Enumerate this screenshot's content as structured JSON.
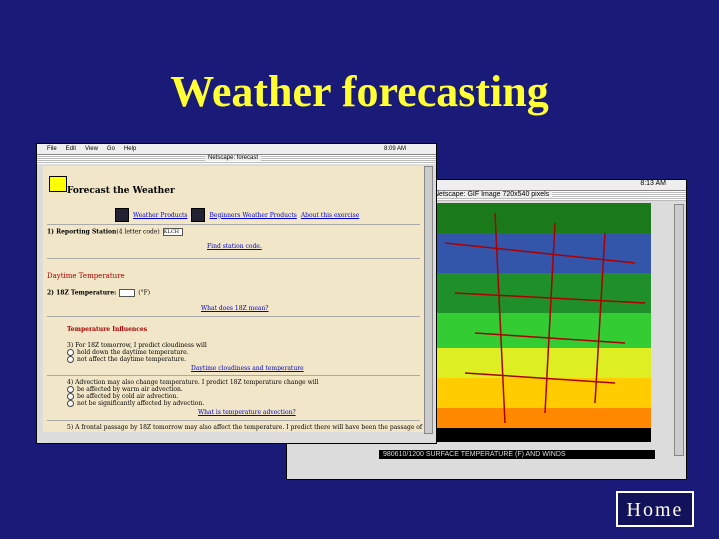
{
  "slide_title": "Weather forecasting",
  "home_label": "Home",
  "front_window": {
    "menus": [
      "File",
      "Edit",
      "View",
      "Go",
      "Help"
    ],
    "clock": "8:09 AM",
    "title": "Netscape: forecast",
    "heading": "Forecast the Weather",
    "nav_links": [
      "Weather Products",
      "Beginners Weather Products",
      "About this exercise"
    ],
    "station_label": "1) Reporting Station",
    "station_hint": "(4 letter code)",
    "station_value": "KLCH",
    "find_station": "Find station code.",
    "daytime_heading": "Daytime Temperature",
    "temp_label": "2) 18Z Temperature:",
    "temp_unit": "(°F)",
    "what_18z": "What does 18Z mean?",
    "influences_heading": "Temperature Influences",
    "q3": "3) For 18Z tomorrow, I predict cloudiness will",
    "q3_options": [
      "hold down the daytime temperature.",
      "not affect the daytime temperature."
    ],
    "q3_link": "Daytime cloudiness and temperature",
    "q4": "4) Advection may also change temperature. I predict 18Z temperature change will",
    "q4_options": [
      "be affected by warm air advection.",
      "be affected by cold air advection.",
      "not be significantly affected by advection."
    ],
    "q4_link": "What is temperature advection?",
    "q5": "5) A frontal passage by 18Z tomorrow may also affect the temperature. I predict there will have been the passage of"
  },
  "back_window": {
    "clock": "8:13 AM",
    "title": "Netscape: GIF Image 720x540 pixels",
    "map_caption": "980610/1200 SURFACE TEMPERATURE (F) AND WINDS"
  },
  "colors": {
    "background": "#1a1a78",
    "title": "#ffff33"
  }
}
